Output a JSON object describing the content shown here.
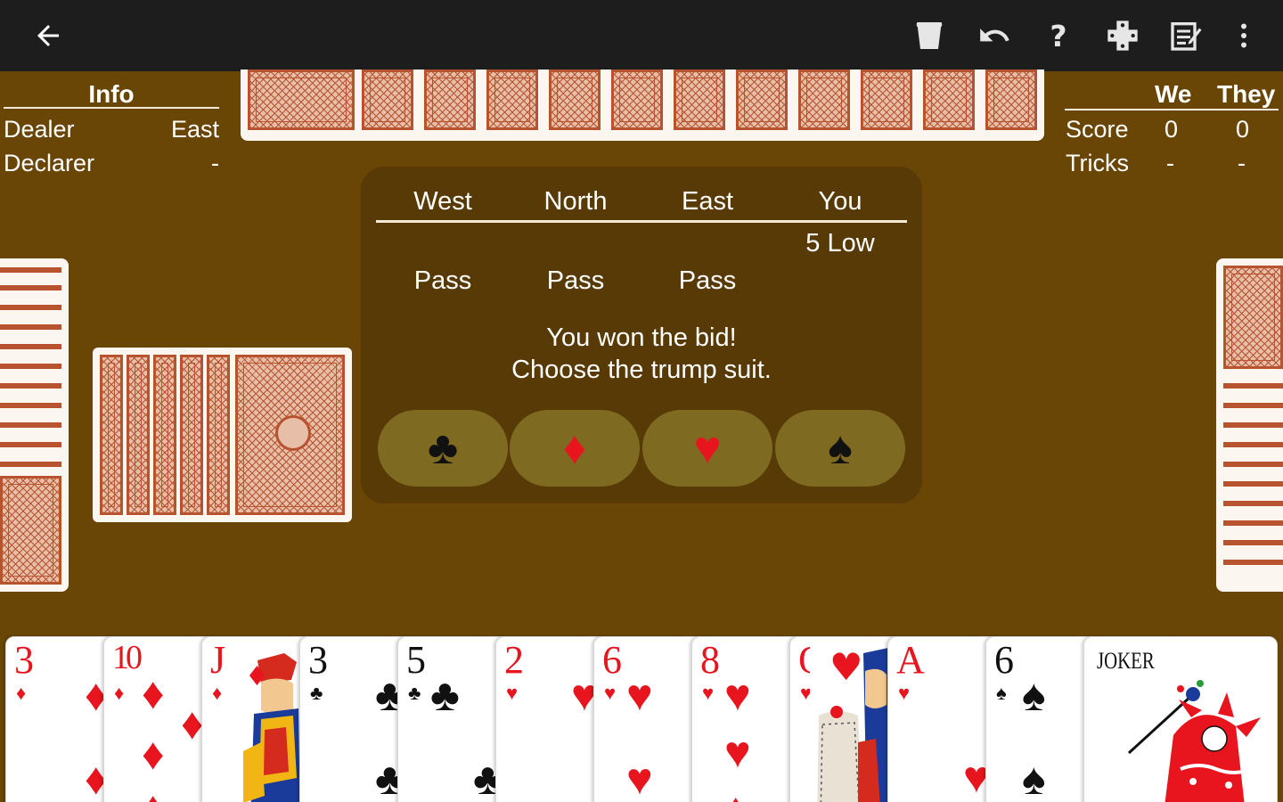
{
  "toolbar": {
    "icons": [
      "back-arrow-icon",
      "trash-icon",
      "undo-icon",
      "help-icon",
      "gamepad-icon",
      "scoresheet-icon",
      "more-vert-icon"
    ]
  },
  "info": {
    "title": "Info",
    "rows": [
      {
        "label": "Dealer",
        "value": "East"
      },
      {
        "label": "Declarer",
        "value": "-"
      }
    ]
  },
  "score": {
    "col_we": "We",
    "col_they": "They",
    "rows": [
      {
        "label": "Score",
        "we": "0",
        "they": "0"
      },
      {
        "label": "Tricks",
        "we": "-",
        "they": "-"
      }
    ]
  },
  "bidding": {
    "players": [
      "West",
      "North",
      "East",
      "You"
    ],
    "round1": [
      "",
      "",
      "",
      "5 Low"
    ],
    "round2": [
      "Pass",
      "Pass",
      "Pass",
      ""
    ],
    "message_line1": "You won the bid!",
    "message_line2": "Choose the trump suit.",
    "suits": [
      {
        "name": "clubs",
        "symbol": "♣",
        "color": "#111111"
      },
      {
        "name": "diamonds",
        "symbol": "♦",
        "color": "#e8141e"
      },
      {
        "name": "hearts",
        "symbol": "♥",
        "color": "#e8141e"
      },
      {
        "name": "spades",
        "symbol": "♠",
        "color": "#111111"
      }
    ]
  },
  "hand": [
    {
      "rank": "3",
      "suit": "♦",
      "color": "red"
    },
    {
      "rank": "10",
      "suit": "♦",
      "color": "red"
    },
    {
      "rank": "J",
      "suit": "♦",
      "color": "red"
    },
    {
      "rank": "3",
      "suit": "♣",
      "color": "black"
    },
    {
      "rank": "5",
      "suit": "♣",
      "color": "black"
    },
    {
      "rank": "2",
      "suit": "♥",
      "color": "red"
    },
    {
      "rank": "6",
      "suit": "♥",
      "color": "red"
    },
    {
      "rank": "8",
      "suit": "♥",
      "color": "red"
    },
    {
      "rank": "Q",
      "suit": "♥",
      "color": "red"
    },
    {
      "rank": "A",
      "suit": "♥",
      "color": "red"
    },
    {
      "rank": "6",
      "suit": "♠",
      "color": "black"
    },
    {
      "rank": "JOKER",
      "suit": "",
      "color": "black"
    }
  ],
  "colors": {
    "table": "#6a4606",
    "panel": "#573a05",
    "suit_button": "#7e6a21",
    "toolbar": "#1d1d1d",
    "card_back": "#b8532f"
  }
}
